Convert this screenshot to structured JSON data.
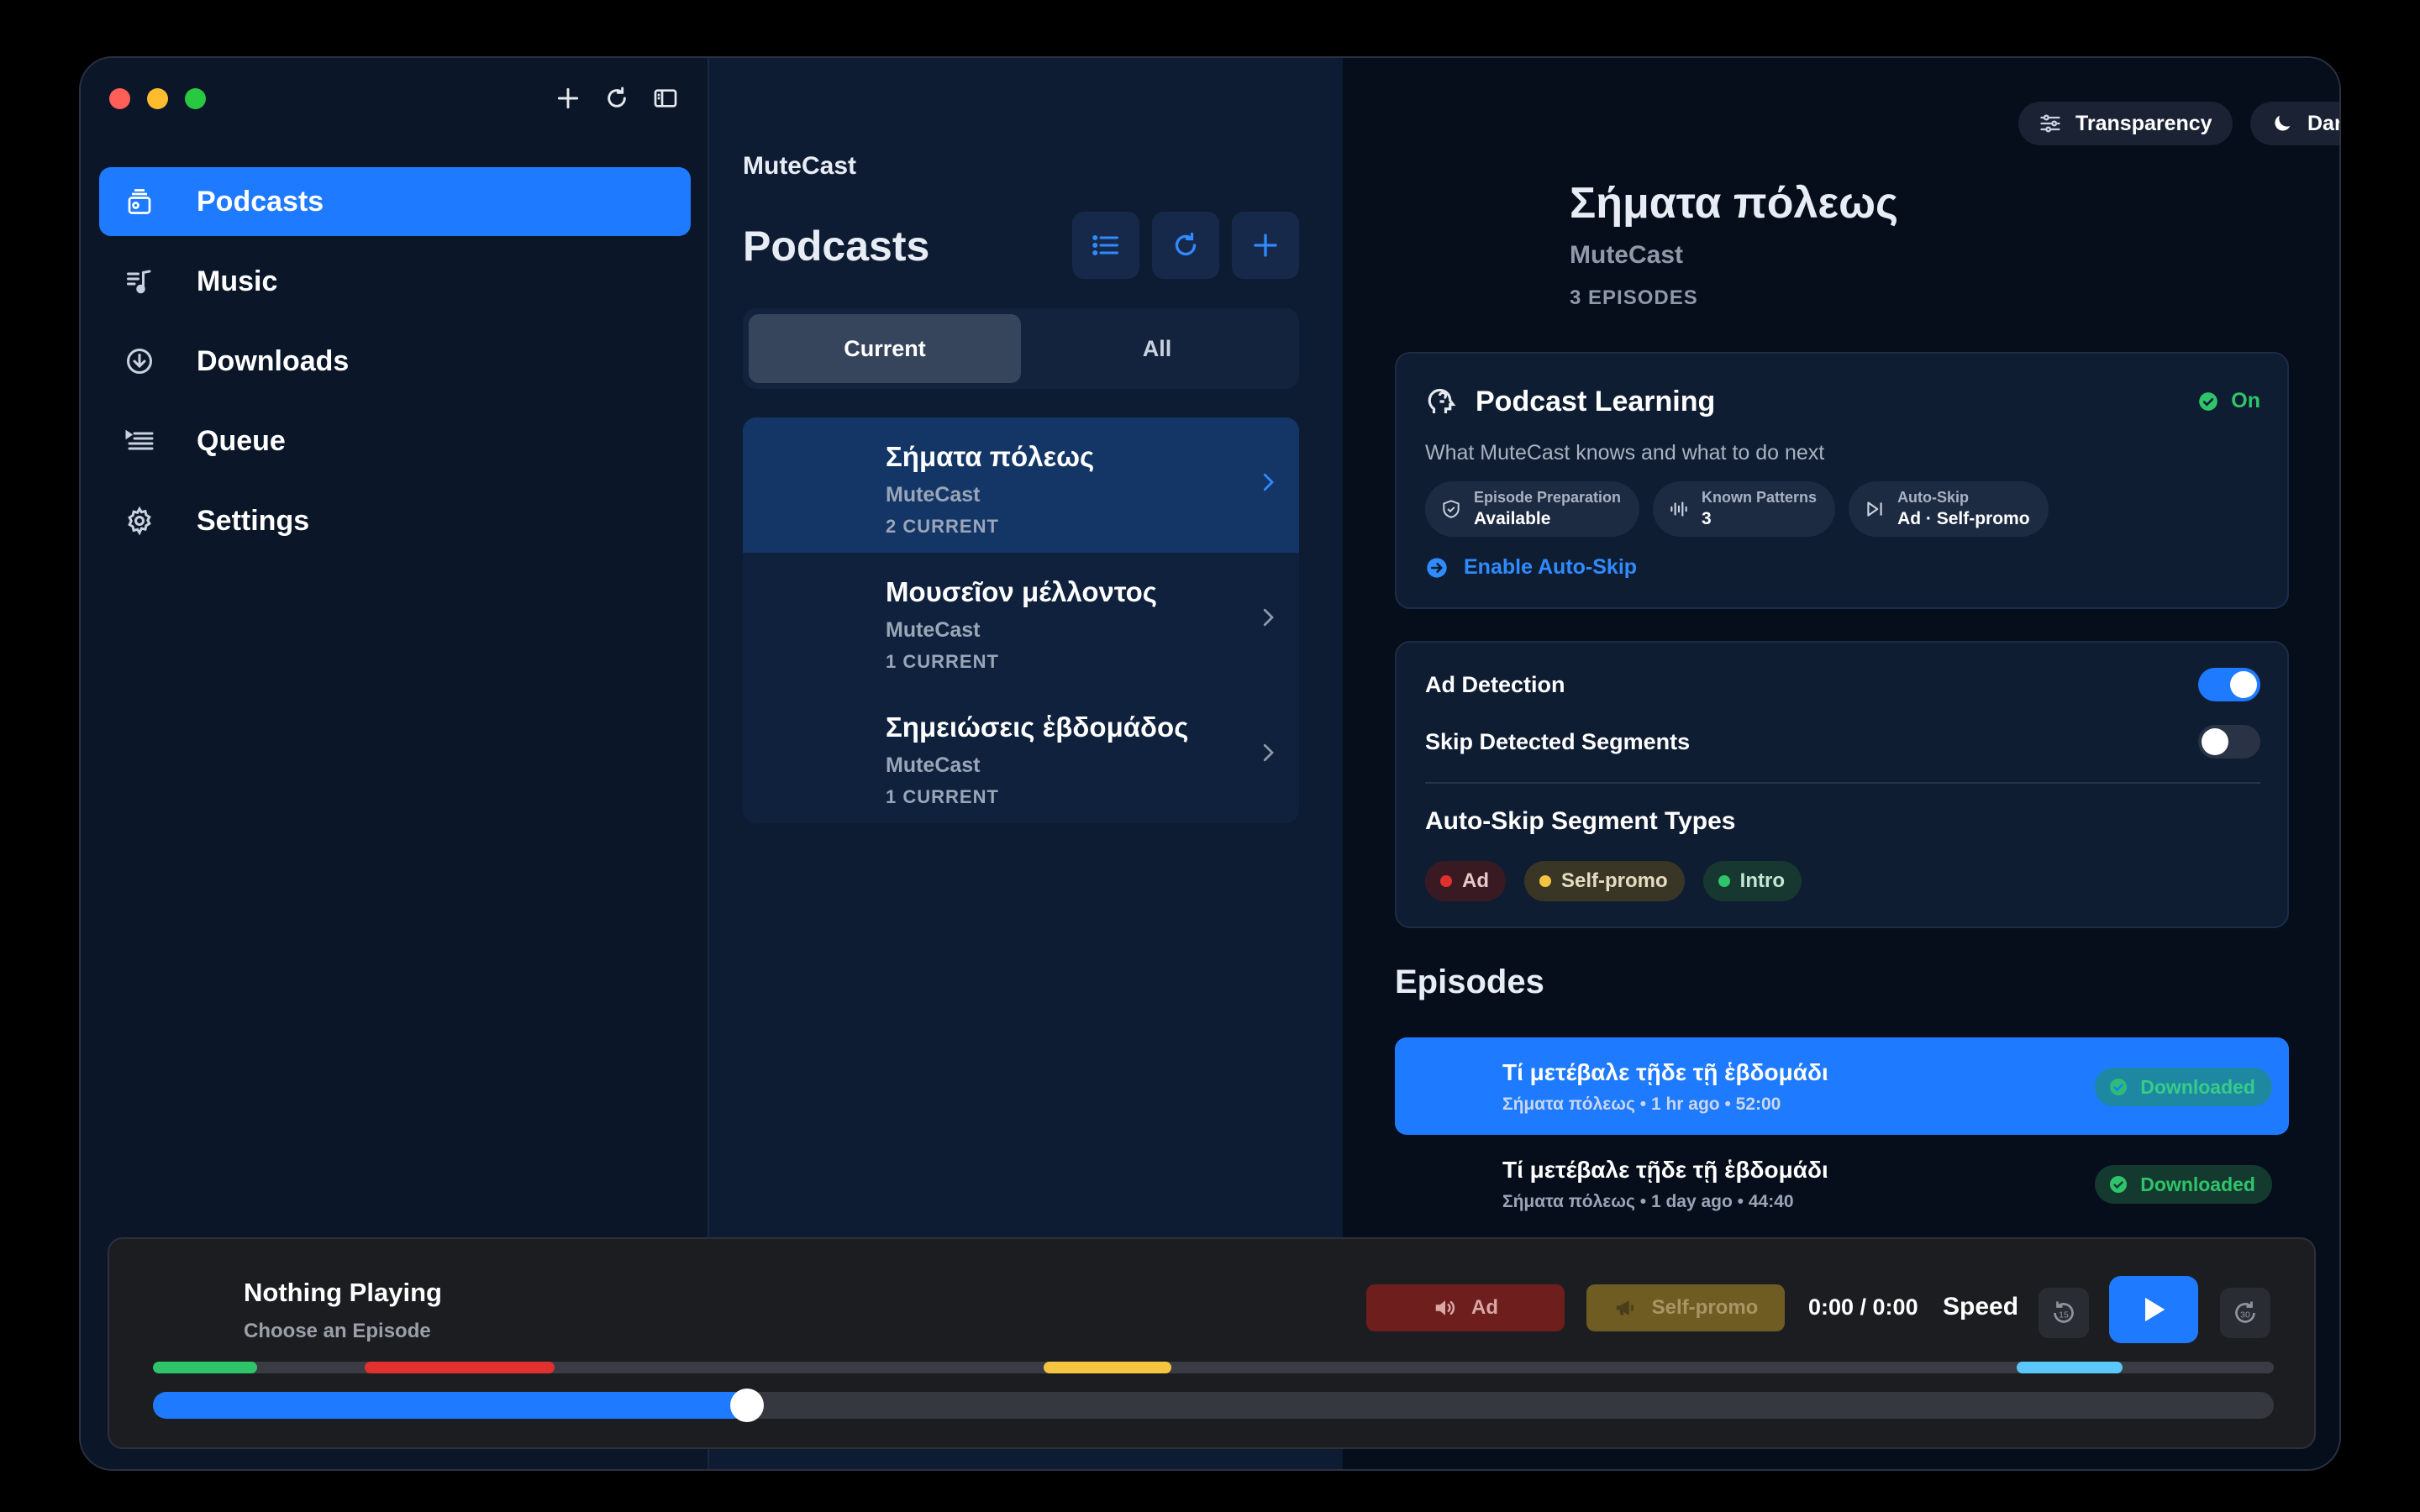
{
  "sidebar": {
    "items": [
      {
        "label": "Podcasts",
        "icon": "podcasts-icon",
        "active": true
      },
      {
        "label": "Music",
        "icon": "music-note-icon",
        "active": false
      },
      {
        "label": "Downloads",
        "icon": "download-icon",
        "active": false
      },
      {
        "label": "Queue",
        "icon": "queue-list-icon",
        "active": false
      },
      {
        "label": "Settings",
        "icon": "gear-icon",
        "active": false
      }
    ]
  },
  "middle": {
    "brand": "MuteCast",
    "title": "Podcasts",
    "tabs": [
      {
        "label": "Current",
        "active": true
      },
      {
        "label": "All",
        "active": false
      }
    ],
    "podcasts": [
      {
        "name": "Σήματα πόλεως",
        "author": "MuteCast",
        "count": "2 CURRENT"
      },
      {
        "name": "Μουσεῖον μέλλοντος",
        "author": "MuteCast",
        "count": "1 CURRENT"
      },
      {
        "name": "Σημειώσεις ἑβδομάδος",
        "author": "MuteCast",
        "count": "1 CURRENT"
      }
    ]
  },
  "detail": {
    "transparency_label": "Transparency",
    "theme_label": "Dark",
    "title": "Σήματα πόλεως",
    "author": "MuteCast",
    "episode_count": "3 EPISODES",
    "learning": {
      "title": "Podcast Learning",
      "status": "On",
      "subtitle": "What MuteCast knows and what to do next",
      "chips": [
        {
          "label": "Episode Preparation",
          "value": "Available"
        },
        {
          "label": "Known Patterns",
          "value": "3"
        },
        {
          "label": "Auto-Skip",
          "value": "Ad · Self-promo"
        }
      ],
      "action": "Enable Auto-Skip"
    },
    "settings": {
      "ad_detection_label": "Ad Detection",
      "ad_detection_on": true,
      "skip_segments_label": "Skip Detected Segments",
      "skip_segments_on": false,
      "segment_types_title": "Auto-Skip Segment Types",
      "segment_types": [
        {
          "label": "Ad",
          "color": "#e0312f"
        },
        {
          "label": "Self-promo",
          "color": "#f5c542"
        },
        {
          "label": "Intro",
          "color": "#2fc46a"
        }
      ]
    },
    "episodes_title": "Episodes",
    "episodes": [
      {
        "title": "Τί μετέβαλε τῇδε τῇ ἑβδομάδι",
        "meta": "Σήματα πόλεως • 1 hr ago • 52:00",
        "badge": "Downloaded"
      },
      {
        "title": "Τί μετέβαλε τῇδε τῇ ἑβδομάδι",
        "meta": "Σήματα πόλεως • 1 day ago • 44:40",
        "badge": "Downloaded"
      }
    ]
  },
  "player": {
    "title": "Nothing Playing",
    "subtitle": "Choose an Episode",
    "ad_button": "Ad",
    "selfpromo_button": "Self-promo",
    "time": "0:00 / 0:00",
    "speed_label": "Speed",
    "progress": 0.28
  },
  "colors": {
    "accent": "#1e7bff",
    "ad": "#e0312f",
    "self_promo": "#f5c542",
    "intro": "#2fc46a",
    "outro": "#5ac8fa"
  }
}
